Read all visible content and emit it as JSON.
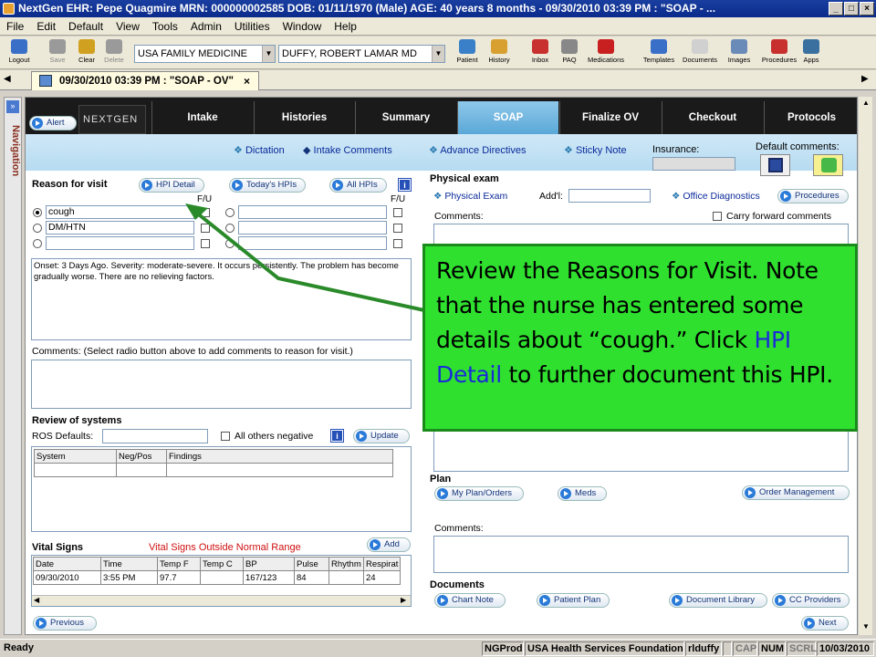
{
  "window": {
    "title": "NextGen EHR: Pepe Quagmire  MRN: 000000002585  DOB: 01/11/1970  (Male)  AGE: 40 years 8 months - 09/30/2010 03:39 PM : \"SOAP - ..."
  },
  "menu": [
    "File",
    "Edit",
    "Default",
    "View",
    "Tools",
    "Admin",
    "Utilities",
    "Window",
    "Help"
  ],
  "toolbar": {
    "left": [
      {
        "label": "Logout",
        "icon": "logout-icon",
        "color": "#3a6fc8",
        "disabled": false
      },
      {
        "label": "Save",
        "icon": "save-icon",
        "color": "#9a9a9a",
        "disabled": true
      },
      {
        "label": "Clear",
        "icon": "clear-icon",
        "color": "#d0a020",
        "disabled": false
      },
      {
        "label": "Delete",
        "icon": "delete-icon",
        "color": "#9a9a9a",
        "disabled": true
      }
    ],
    "practice": "USA FAMILY MEDICINE",
    "provider": "DUFFY, ROBERT  LAMAR MD",
    "right": [
      {
        "label": "Patient",
        "icon": "patient-icon",
        "color": "#3a80c8"
      },
      {
        "label": "History",
        "icon": "history-icon",
        "color": "#d8a030"
      },
      {
        "label": "Inbox",
        "icon": "inbox-icon",
        "color": "#c83030"
      },
      {
        "label": "PAQ",
        "icon": "paq-icon",
        "color": "#888888"
      },
      {
        "label": "Medications",
        "icon": "rx-icon",
        "color": "#c82020"
      },
      {
        "label": "Templates",
        "icon": "templates-icon",
        "color": "#3a6fc8"
      },
      {
        "label": "Documents",
        "icon": "documents-icon",
        "color": "#d0d0d0"
      },
      {
        "label": "Images",
        "icon": "images-icon",
        "color": "#6a8ab8"
      },
      {
        "label": "Procedures",
        "icon": "procedures-icon",
        "color": "#c83030"
      },
      {
        "label": "Apps",
        "icon": "apps-icon",
        "color": "#3a70a0"
      }
    ]
  },
  "doc_tab": "09/30/2010 03:39 PM : \"SOAP - OV\"",
  "navigation_label": "Navigation",
  "form": {
    "alert": "Alert",
    "logo": "NEXTGEN",
    "tabs": [
      "Intake",
      "Histories",
      "Summary",
      "SOAP",
      "Finalize OV",
      "Checkout",
      "Protocols"
    ],
    "active_tab": "SOAP",
    "links": {
      "dictation": "Dictation",
      "intake_comments": "Intake Comments",
      "advance_directives": "Advance Directives",
      "sticky_note": "Sticky Note",
      "insurance": "Insurance:",
      "default_comments": "Default comments:"
    },
    "reason_for_visit": {
      "title": "Reason for visit",
      "hpi_detail": "HPI Detail",
      "todays_hpis": "Today's HPIs",
      "all_hpis": "All HPIs",
      "fu": "F/U",
      "rows_left": [
        "cough",
        "DM/HTN",
        ""
      ],
      "rows_right": [
        "",
        "",
        ""
      ],
      "narrative": "Onset: 3 Days Ago.  Severity: moderate-severe.  It occurs persistently.  The problem has become gradually worse.  There are no relieving factors.",
      "comments_label": "Comments:  (Select radio button above to add comments to reason for visit.)"
    },
    "ros": {
      "title": "Review of systems",
      "defaults_label": "ROS Defaults:",
      "all_others_negative": "All others negative",
      "update": "Update",
      "columns": [
        "System",
        "Neg/Pos",
        "Findings"
      ]
    },
    "vitals": {
      "title": "Vital Signs",
      "warning": "Vital Signs Outside Normal Range",
      "add": "Add",
      "columns": [
        "Date",
        "Time",
        "Temp F",
        "Temp C",
        "BP",
        "Pulse",
        "Rhythm",
        "Respirat"
      ],
      "rows": [
        [
          "09/30/2010",
          "3:55 PM",
          "97.7",
          "",
          "167/123",
          "84",
          "",
          "24"
        ]
      ]
    },
    "physical_exam": {
      "title": "Physical exam",
      "physical_exam_link": "Physical Exam",
      "addl": "Add'l:",
      "office_diagnostics": "Office Diagnostics",
      "procedures": "Procedures",
      "comments_label": "Comments:",
      "carry_forward": "Carry forward comments"
    },
    "plan": {
      "title": "Plan",
      "my_plan_orders": "My Plan/Orders",
      "meds": "Meds",
      "order_management": "Order Management",
      "comments_label": "Comments:"
    },
    "documents": {
      "title": "Documents",
      "chart_note": "Chart Note",
      "patient_plan": "Patient Plan",
      "document_library": "Document Library",
      "cc_providers": "CC Providers"
    },
    "previous": "Previous",
    "next": "Next"
  },
  "callout": {
    "before": "Review the Reasons for Visit.  Note that the nurse has entered some details about “cough.”  Click ",
    "highlight": "HPI Detail",
    "after": " to further document this HPI."
  },
  "status": {
    "ready": "Ready",
    "db": "NGProd",
    "org": "USA Health Services Foundation",
    "user": "rlduffy",
    "cap": "CAP",
    "num": "NUM",
    "scrl": "SCRL",
    "date": "10/03/2010"
  },
  "colors": {
    "callout_bg": "#2fe02f",
    "callout_border": "#1a8a1a",
    "arrow": "#2a8a2a",
    "active_tab": "#6ab4e0",
    "warning_red": "#d01010"
  }
}
